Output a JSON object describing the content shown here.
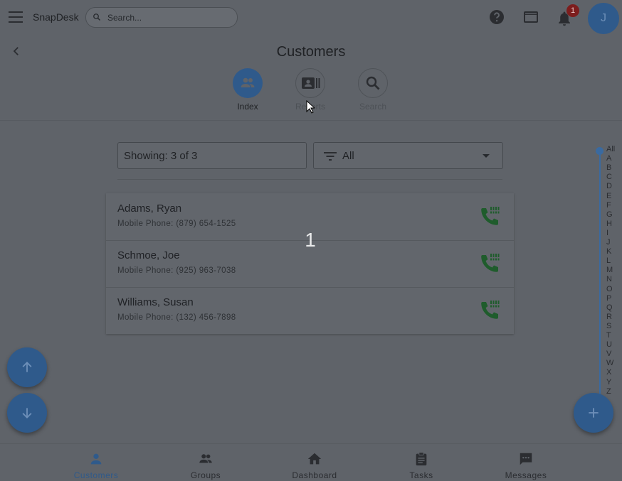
{
  "header": {
    "app_name": "SnapDesk",
    "search_placeholder": "Search...",
    "notification_count": "1",
    "avatar_initial": "J"
  },
  "page": {
    "title": "Customers"
  },
  "subtabs": [
    {
      "label": "Index",
      "icon": "people-icon",
      "active": true
    },
    {
      "label": "Reports",
      "icon": "contact-card-icon",
      "active": false
    },
    {
      "label": "Search",
      "icon": "search-icon",
      "active": false
    }
  ],
  "filters": {
    "showing_text": "Showing: 3 of 3",
    "filter_value": "All"
  },
  "customers": [
    {
      "name": "Adams, Ryan",
      "phone": "Mobile Phone: (879) 654-1525"
    },
    {
      "name": "Schmoe, Joe",
      "phone": "Mobile Phone: (925) 963-7038"
    },
    {
      "name": "Williams, Susan",
      "phone": "Mobile Phone: (132) 456-7898"
    }
  ],
  "overlay_number": "1",
  "alphabet": [
    "All",
    "A",
    "B",
    "C",
    "D",
    "E",
    "F",
    "G",
    "H",
    "I",
    "J",
    "K",
    "L",
    "M",
    "N",
    "O",
    "P",
    "Q",
    "R",
    "S",
    "T",
    "U",
    "V",
    "W",
    "X",
    "Y",
    "Z"
  ],
  "bottom_nav": [
    {
      "label": "Customers",
      "icon": "person-icon",
      "active": true
    },
    {
      "label": "Groups",
      "icon": "people-icon",
      "active": false
    },
    {
      "label": "Dashboard",
      "icon": "home-icon",
      "active": false
    },
    {
      "label": "Tasks",
      "icon": "clipboard-icon",
      "active": false
    },
    {
      "label": "Messages",
      "icon": "chat-icon",
      "active": false
    }
  ],
  "colors": {
    "background": "#5f6369",
    "accent": "#2f5a8b",
    "call_icon": "#1f5c2c",
    "badge": "#7d1d1d"
  }
}
